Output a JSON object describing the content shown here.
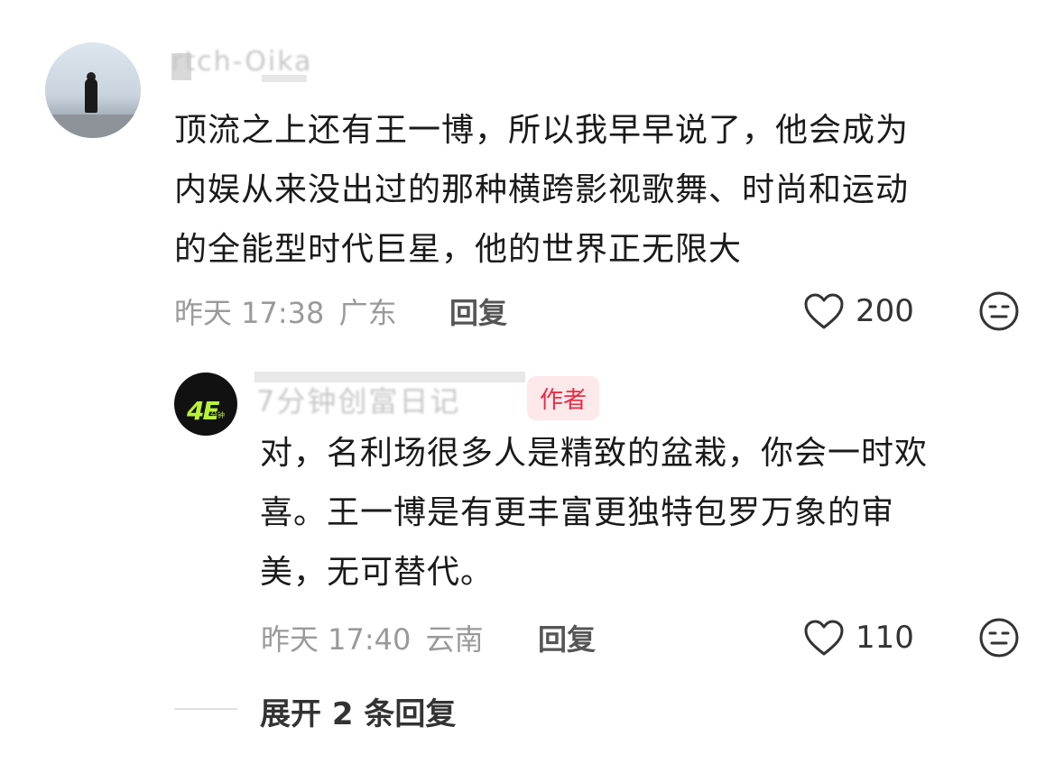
{
  "comment": {
    "username_blurred": "rtch-Oika",
    "text_lines": [
      "顶流之上还有王一博，所以我早早说了，他会成为",
      "内娱从来没出过的那种横跨影视歌舞、时尚和运动",
      "的全能型时代巨星，他的世界正无限大"
    ],
    "time": "昨天 17:38",
    "location": "广东",
    "reply_label": "回复",
    "likes": "200"
  },
  "reply": {
    "username_blurred": "7分钟创富日记",
    "author_badge": "作者",
    "avatar_text": "4E",
    "avatar_subtext": "分钟",
    "text_lines": [
      "对，名利场很多人是精致的盆栽，你会一时欢",
      "喜。王一博是有更丰富更独特包罗万象的审",
      "美，无可替代。"
    ],
    "time": "昨天 17:40",
    "location": "云南",
    "reply_label": "回复",
    "likes": "110"
  },
  "expand": {
    "label": "展开 2 条回复"
  },
  "icons": {
    "like": "heart-outline-icon",
    "emoji": "neutral-face-icon"
  }
}
